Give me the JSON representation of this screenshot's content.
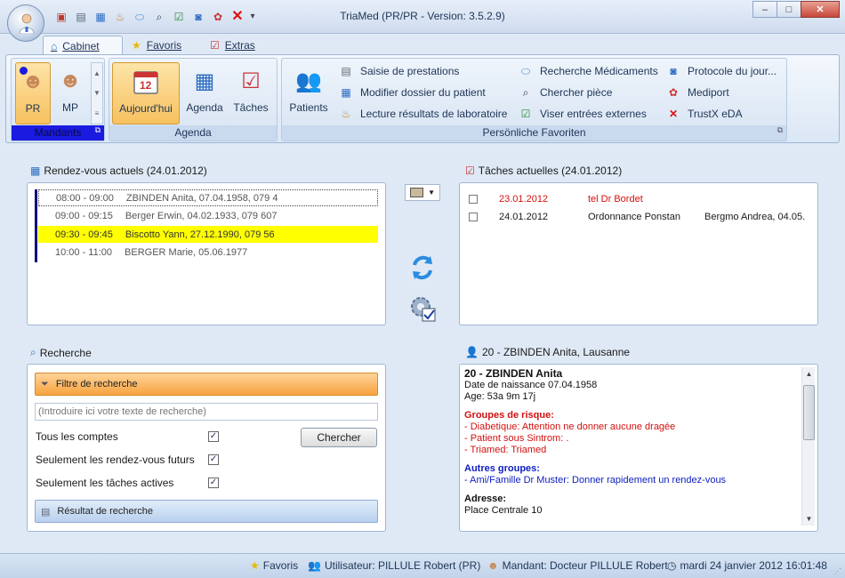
{
  "window": {
    "title": "TriaMed (PR/PR - Version: 3.5.2.9)",
    "controls": {
      "minimize": "–",
      "maximize": "□",
      "close": "✕"
    }
  },
  "quick_access": [
    "contact-card-icon",
    "document-icon",
    "patient-card-icon",
    "lab-icon",
    "pill-icon",
    "search-icon",
    "check-doc-icon",
    "protocol-icon",
    "mediport-icon",
    "trustx-icon"
  ],
  "tabs": [
    {
      "label": "Cabinet",
      "active": true
    },
    {
      "label": "Favoris",
      "active": false
    },
    {
      "label": "Extras",
      "active": false
    }
  ],
  "ribbon": {
    "mandants": {
      "label": "Mandants",
      "items": [
        "PR",
        "MP"
      ]
    },
    "agenda": {
      "label": "Agenda",
      "items": [
        "Aujourd'hui",
        "Agenda",
        "Tâches"
      ],
      "calendar_day": "12"
    },
    "favoris": {
      "label": "Persönliche Favoriten",
      "patients": "Patients",
      "col1": [
        "Saisie de prestations",
        "Modifier dossier du patient",
        "Lecture résultats de laboratoire"
      ],
      "col2": [
        "Recherche Médicaments",
        "Chercher pièce",
        "Viser entrées externes"
      ],
      "col3": [
        "Protocole du jour...",
        "Mediport",
        "TrustX eDA"
      ]
    }
  },
  "appointments": {
    "title": "Rendez-vous actuels (24.01.2012)",
    "items": [
      {
        "time": "08:00 - 09:00",
        "patient": "ZBINDEN Anita, 07.04.1958, 079 4"
      },
      {
        "time": "09:00 - 09:15",
        "patient": "Berger Erwin, 04.02.1933, 079 607"
      },
      {
        "time": "09:30 - 09:45",
        "patient": "Biscotto Yann, 27.12.1990, 079 56"
      },
      {
        "time": "10:00 - 11:00",
        "patient": "BERGER Marie, 05.06.1977"
      }
    ]
  },
  "tasks": {
    "title": "Tâches actuelles (24.01.2012)",
    "items": [
      {
        "date": "23.01.2012",
        "text": "tel Dr Bordet",
        "patient": ""
      },
      {
        "date": "24.01.2012",
        "text": "Ordonnance Ponstan",
        "patient": "Bergmo Andrea, 04.05."
      }
    ]
  },
  "search": {
    "title": "Recherche",
    "filter_label": "Filtre de recherche",
    "placeholder": "(Introduire ici votre texte de recherche)",
    "button": "Chercher",
    "options": [
      {
        "label": "Tous les comptes",
        "checked": true
      },
      {
        "label": "Seulement les rendez-vous futurs",
        "checked": true
      },
      {
        "label": "Seulement les tâches actives",
        "checked": true
      }
    ],
    "result_label": "Résultat de recherche"
  },
  "patient": {
    "title": "20 - ZBINDEN Anita, Lausanne",
    "heading": "20 - ZBINDEN Anita",
    "birth": "Date de naissance 07.04.1958",
    "age": "Age: 53a 9m 17j",
    "risk_title": "Groupes de risque:",
    "risks": [
      "- Diabetique: Attention ne donner aucune dragée",
      "- Patient sous Sintrom: .",
      "- Triamed: Triamed"
    ],
    "other_title": "Autres groupes:",
    "others": [
      "- Ami/Famille Dr Muster: Donner rapidement un rendez-vous"
    ],
    "address_title": "Adresse:",
    "address": "Place Centrale 10"
  },
  "status": {
    "favoris": "Favoris",
    "user": "Utilisateur: PILLULE Robert   (PR)",
    "mandant": "Mandant: Docteur PILLULE Robert",
    "datetime": "mardi 24 janvier 2012 16:01:48"
  },
  "colors": {
    "accent": "#f7a33e",
    "highlight": "#ffff00",
    "mandant_label": "#1a1ae0",
    "risk": "#d21010",
    "group": "#1020c0"
  }
}
